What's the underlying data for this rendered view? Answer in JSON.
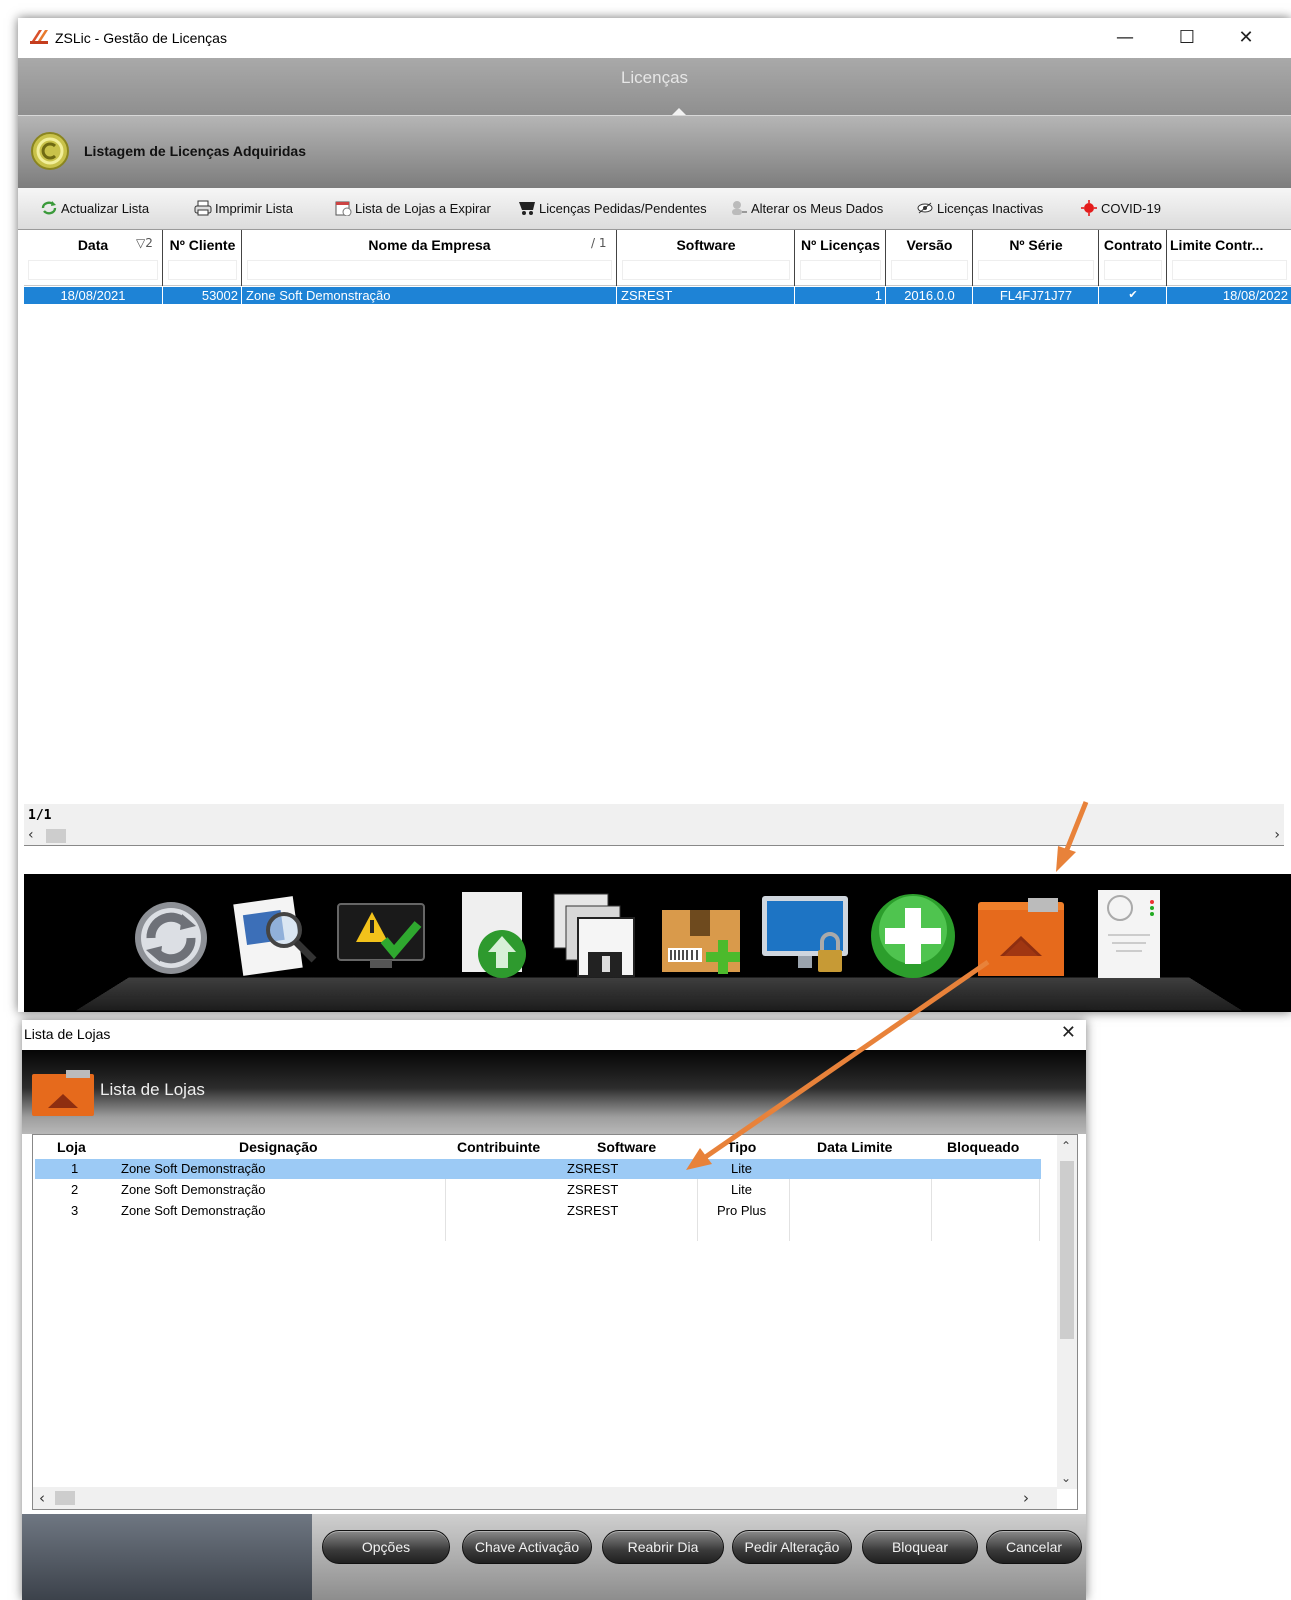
{
  "main_window": {
    "title": "ZSLic - Gestão de Licenças",
    "controls": {
      "minimize": "—",
      "maximize": "☐",
      "close": "✕"
    },
    "banner_title": "Licenças",
    "header_title": "Listagem de Licenças Adquiridas",
    "toolbar": [
      {
        "label": "Actualizar Lista",
        "icon": "refresh-arrows-icon"
      },
      {
        "label": "Imprimir Lista",
        "icon": "printer-icon"
      },
      {
        "label": "Lista de Lojas a Expirar",
        "icon": "calendar-icon"
      },
      {
        "label": "Licenças Pedidas/Pendentes",
        "icon": "cart-icon"
      },
      {
        "label": "Alterar os Meus Dados",
        "icon": "user-key-icon"
      },
      {
        "label": "Licenças Inactivas",
        "icon": "eye-icon"
      },
      {
        "label": "COVID-19",
        "icon": "virus-icon"
      }
    ],
    "grid": {
      "columns": [
        {
          "label": "Data",
          "sort": "▽2"
        },
        {
          "label": "Nº Cliente"
        },
        {
          "label": "Nome da Empresa",
          "sort": "/ 1"
        },
        {
          "label": "Software"
        },
        {
          "label": "Nº Licenças"
        },
        {
          "label": "Versão"
        },
        {
          "label": "Nº Série"
        },
        {
          "label": "Contrato"
        },
        {
          "label": "Limite Contr..."
        }
      ],
      "rows": [
        {
          "data": "18/08/2021",
          "cliente": "53002",
          "empresa": "Zone Soft Demonstração",
          "software": "ZSREST",
          "licencas": "1",
          "versao": "2016.0.0",
          "serie": "FL4FJ71J77",
          "contrato": "✔",
          "limite": "18/08/2022"
        }
      ],
      "pager": "1/1"
    },
    "dock": [
      {
        "icon": "sync-circle-icon"
      },
      {
        "icon": "document-magnifier-icon"
      },
      {
        "icon": "monitor-warning-check-icon"
      },
      {
        "icon": "document-upload-icon"
      },
      {
        "icon": "floppy-disks-icon"
      },
      {
        "icon": "package-add-icon"
      },
      {
        "icon": "monitor-lock-icon"
      },
      {
        "icon": "green-plus-icon"
      },
      {
        "icon": "orange-house-folder-icon"
      },
      {
        "icon": "certificate-document-icon"
      }
    ]
  },
  "dialog": {
    "title": "Lista de Lojas",
    "close": "✕",
    "header_title": "Lista de Lojas",
    "columns": [
      "Loja",
      "Designação",
      "Contribuinte",
      "Software",
      "Tipo",
      "Data Limite",
      "Bloqueado"
    ],
    "rows": [
      {
        "loja": "1",
        "designacao": "Zone Soft Demonstração",
        "contribuinte": "",
        "software": "ZSREST",
        "tipo": "Lite",
        "data_limite": "",
        "bloqueado": ""
      },
      {
        "loja": "2",
        "designacao": "Zone Soft Demonstração",
        "contribuinte": "",
        "software": "ZSREST",
        "tipo": "Lite",
        "data_limite": "",
        "bloqueado": ""
      },
      {
        "loja": "3",
        "designacao": "Zone Soft Demonstração",
        "contribuinte": "",
        "software": "ZSREST",
        "tipo": "Pro Plus",
        "data_limite": "",
        "bloqueado": ""
      }
    ],
    "buttons": [
      "Opções",
      "Chave Activação",
      "Reabrir Dia",
      "Pedir Alteração",
      "Bloquear",
      "Cancelar"
    ]
  },
  "colors": {
    "selection_blue": "#1e83d6",
    "dialog_selection": "#9ccaf5",
    "annotation_arrow": "#e8823a"
  }
}
